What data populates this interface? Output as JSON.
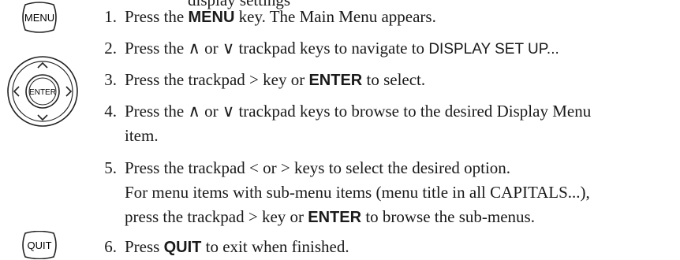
{
  "header_fragment": "display settings",
  "icons": {
    "menu_key": "MENU",
    "enter_key": "ENTER",
    "quit_key": "QUIT"
  },
  "steps": [
    {
      "num": "1.",
      "parts": [
        "Press the ",
        "MENU",
        " key. The Main Menu appears."
      ]
    },
    {
      "num": "2.",
      "parts": [
        "Press the ∧ or ∨ trackpad keys to navigate to ",
        "DISPLAY SET UP..."
      ]
    },
    {
      "num": "3.",
      "parts": [
        "Press the trackpad > key or ",
        "ENTER",
        " to select."
      ]
    },
    {
      "num": "4.",
      "parts": [
        "Press the ∧ or ∨ trackpad keys to browse to the desired Display Menu",
        "item."
      ]
    },
    {
      "num": "5.",
      "parts": [
        "Press the trackpad < or > keys to select the desired option.",
        "For menu items with sub-menu items (menu title in all CAPITALS...),",
        "press the trackpad > key or ",
        "ENTER",
        " to browse the sub-menus."
      ]
    },
    {
      "num": "6.",
      "parts": [
        "Press ",
        "QUIT",
        " to exit when finished."
      ]
    }
  ]
}
